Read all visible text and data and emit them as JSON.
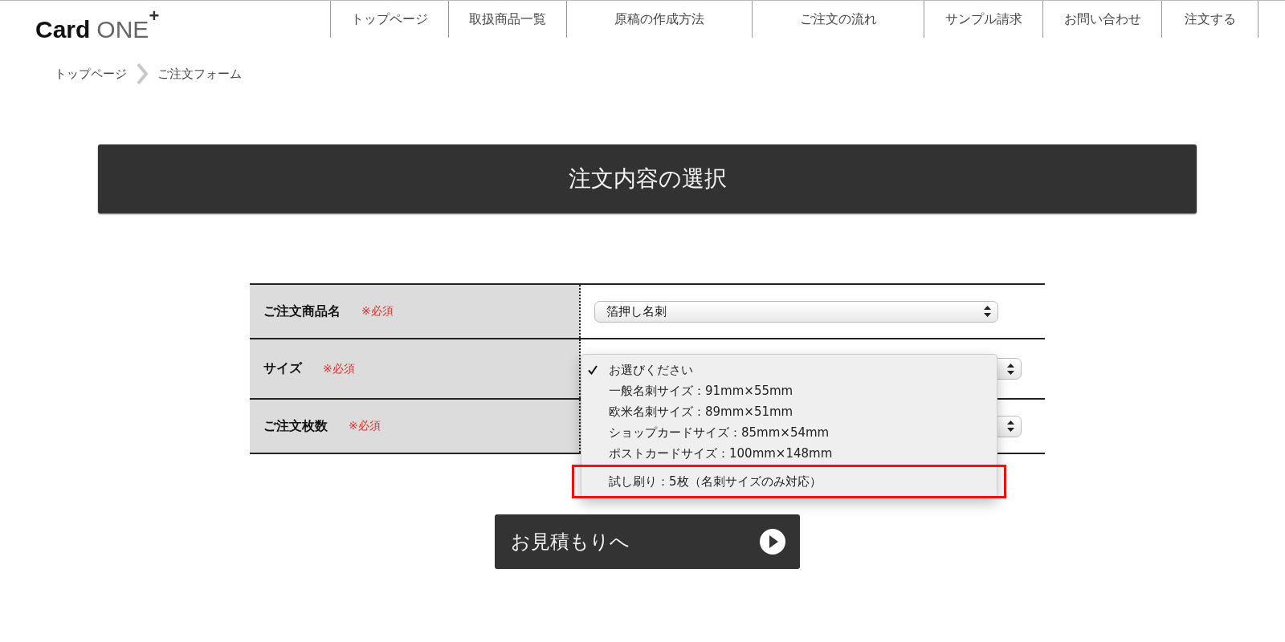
{
  "header": {
    "logo": {
      "word_1": "Card",
      "word_2": "ONE",
      "mark": "+"
    },
    "nav": [
      {
        "label": "トップページ"
      },
      {
        "label": "取扱商品一覧"
      },
      {
        "label": "原稿の作成方法"
      },
      {
        "label": "ご注文の流れ"
      },
      {
        "label": "サンプル請求"
      },
      {
        "label": "お問い合わせ"
      },
      {
        "label": "注文する"
      }
    ]
  },
  "breadcrumb": [
    {
      "label": "トップページ"
    },
    {
      "label": "ご注文フォーム"
    }
  ],
  "section_title": "注文内容の選択",
  "form": {
    "rows": [
      {
        "label": "ご注文商品名",
        "required": "※必須",
        "select": {
          "value": "箔押し名刺"
        }
      },
      {
        "label": "サイズ",
        "required": "※必須",
        "select": {
          "open": true,
          "options": [
            {
              "label": "お選びください",
              "selected": true,
              "highlighted": false
            },
            {
              "label": "一般名刺サイズ：91mm×55mm",
              "selected": false,
              "highlighted": false
            },
            {
              "label": "欧米名刺サイズ：89mm×51mm",
              "selected": false,
              "highlighted": false
            },
            {
              "label": "ショップカードサイズ：85mm×54mm",
              "selected": false,
              "highlighted": false
            },
            {
              "label": "ポストカードサイズ：100mm×148mm",
              "selected": false,
              "highlighted": false
            },
            {
              "label": "試し刷り：5枚（名刺サイズのみ対応）",
              "selected": false,
              "highlighted": true
            }
          ]
        }
      },
      {
        "label": "ご注文枚数",
        "required": "※必須",
        "select": {}
      }
    ]
  },
  "submit_button": {
    "label": "お見積もりへ"
  }
}
